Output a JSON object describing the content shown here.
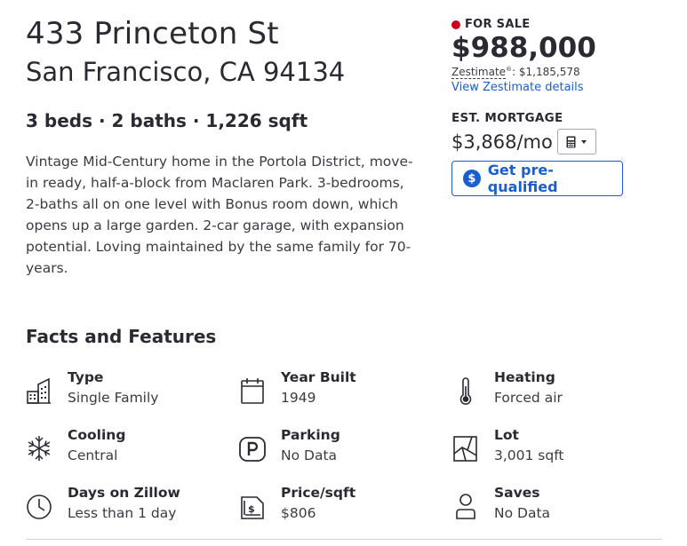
{
  "listing": {
    "address_line1": "433 Princeton St",
    "address_line2": "San Francisco, CA 94134",
    "specs": "3 beds · 2 baths · 1,226 sqft",
    "description": "Vintage Mid-Century home in the Portola District, move-in ready, half-a-block from Maclaren Park. 3-bedrooms, 2-baths all on one level with Bonus room down, which opens up a large garden. 2-car garage, with expansion potential. Loving maintained by the same family for 70-years."
  },
  "pricing": {
    "status": "FOR SALE",
    "status_color": "#d0021b",
    "price": "$988,000",
    "zestimate_label": "Zestimate",
    "zestimate_mark": "®",
    "zestimate_value": ": $1,185,578",
    "zestimate_link": "View Zestimate details",
    "mortgage_label": "EST. MORTGAGE",
    "mortgage_value": "$3,868/mo",
    "prequal_icon": "$",
    "prequal_label": "Get pre-qualified",
    "accent_color": "#1a5fcf"
  },
  "facts": {
    "title": "Facts and Features",
    "items": [
      {
        "icon": "building-icon",
        "label": "Type",
        "value": "Single Family"
      },
      {
        "icon": "calendar-icon",
        "label": "Year Built",
        "value": "1949"
      },
      {
        "icon": "thermometer-icon",
        "label": "Heating",
        "value": "Forced air"
      },
      {
        "icon": "snowflake-icon",
        "label": "Cooling",
        "value": "Central"
      },
      {
        "icon": "parking-icon",
        "label": "Parking",
        "value": "No Data"
      },
      {
        "icon": "lot-icon",
        "label": "Lot",
        "value": "3,001 sqft"
      },
      {
        "icon": "clock-icon",
        "label": "Days on Zillow",
        "value": "Less than 1 day"
      },
      {
        "icon": "price-tag-icon",
        "label": "Price/sqft",
        "value": "$806"
      },
      {
        "icon": "person-icon",
        "label": "Saves",
        "value": "No Data"
      }
    ]
  }
}
